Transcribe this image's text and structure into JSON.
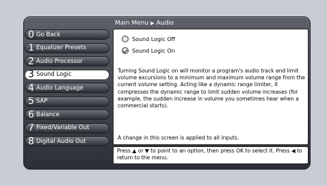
{
  "breadcrumb": {
    "main": "Main Menu",
    "current": "Audio"
  },
  "menu": [
    {
      "num": "0",
      "label": "Go Back"
    },
    {
      "num": "1",
      "label": "Equalizer Presets"
    },
    {
      "num": "2",
      "label": "Audio Processor"
    },
    {
      "num": "3",
      "label": "Sound Logic",
      "selected": true
    },
    {
      "num": "4",
      "label": "Audio Language"
    },
    {
      "num": "5",
      "label": "SAP"
    },
    {
      "num": "6",
      "label": "Balance"
    },
    {
      "num": "7",
      "label": "Fixed/Variable Out"
    },
    {
      "num": "8",
      "label": "Digital Audio Out"
    }
  ],
  "options": [
    {
      "label": "Sound Logic Off",
      "checked": false
    },
    {
      "label": "Sound Logic On",
      "checked": true
    }
  ],
  "description": "Turning Sound Logic on will monitor a program's audio track and limit volume excursions to a minimum and maximum volume range from the current volume setting. Acting like a dynamic range limiter, it compresses the dynamic range to limit sudden volume increases (for example, the sudden increase in volume you sometimes hear when a commercial starts).",
  "note": "A change in this screen is applied to all inputs.",
  "help": "Press ▲ or ▼ to point to an option, then press OK to select it. Press ◀ to return to the menu."
}
